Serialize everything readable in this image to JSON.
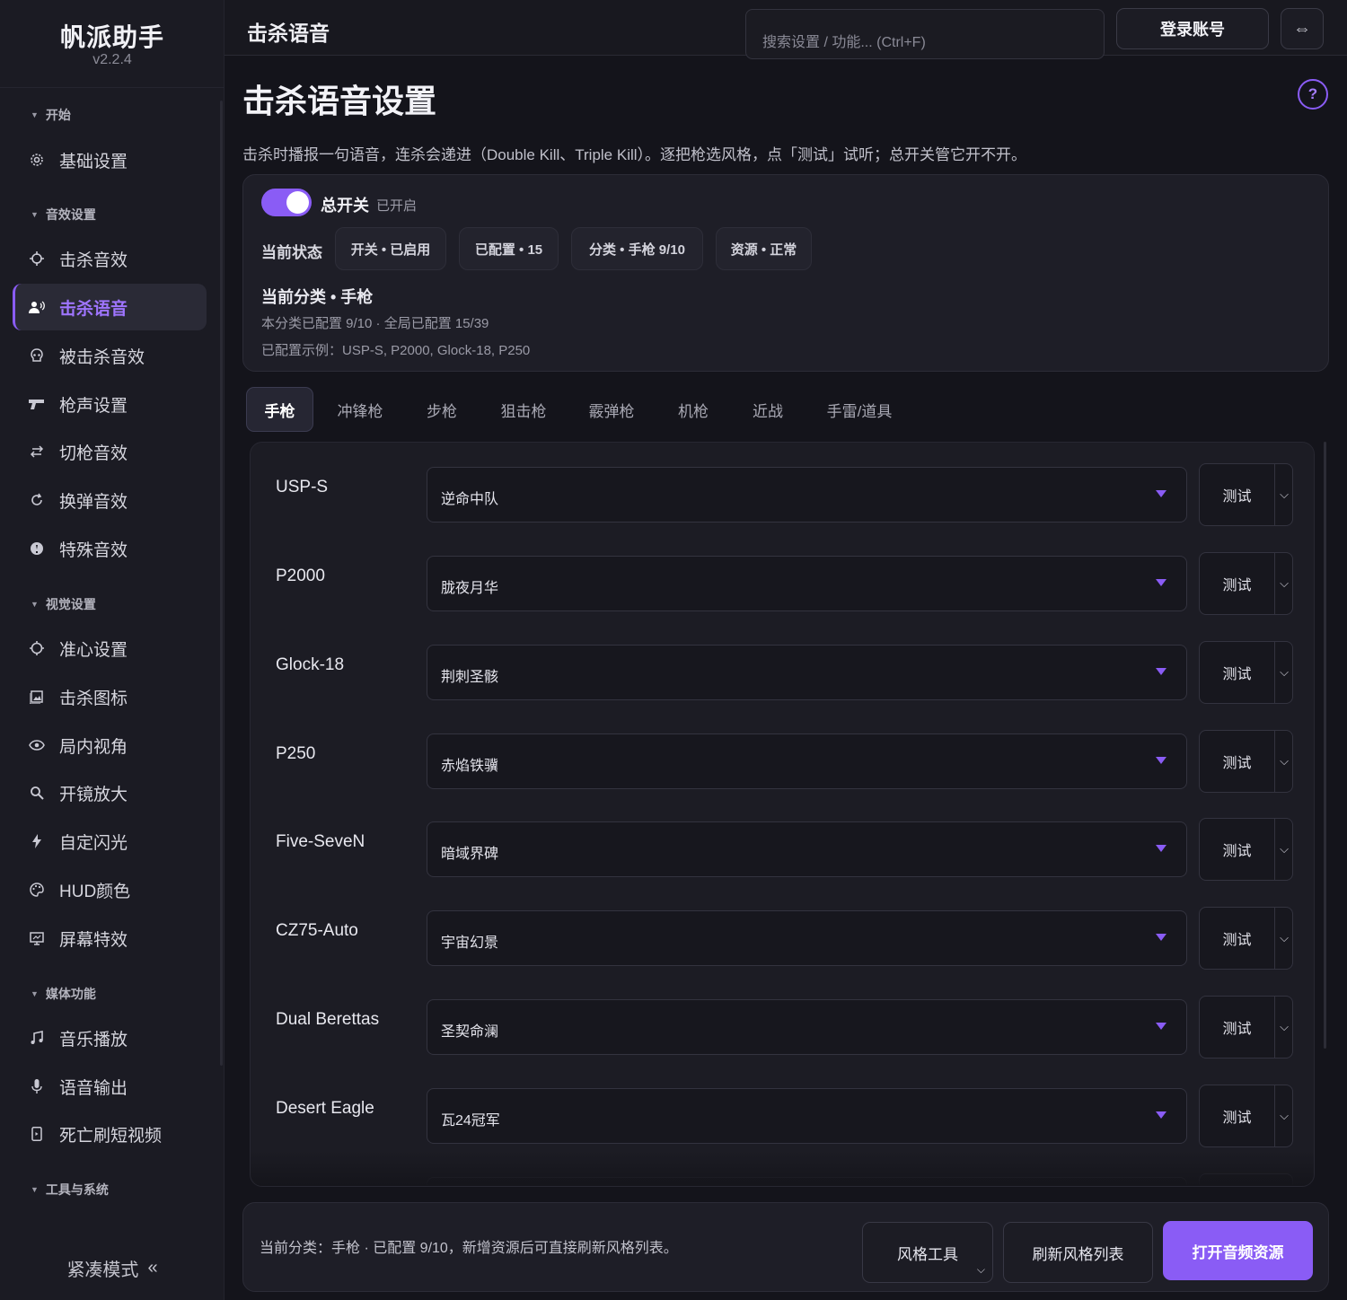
{
  "app": {
    "name": "帆派助手",
    "version": "v2.2.4"
  },
  "sidebar": {
    "groups": [
      {
        "label": "开始"
      },
      {
        "label": "音效设置"
      },
      {
        "label": "视觉设置"
      },
      {
        "label": "媒体功能"
      },
      {
        "label": "工具与系统"
      }
    ],
    "items": [
      {
        "label": "基础设置",
        "icon": "gear-icon"
      },
      {
        "label": "击杀音效",
        "icon": "crosshair-icon"
      },
      {
        "label": "击杀语音",
        "icon": "voice-icon",
        "active": true
      },
      {
        "label": "被击杀音效",
        "icon": "skull-icon"
      },
      {
        "label": "枪声设置",
        "icon": "gun-icon"
      },
      {
        "label": "切枪音效",
        "icon": "swap-icon"
      },
      {
        "label": "换弹音效",
        "icon": "reload-icon"
      },
      {
        "label": "特殊音效",
        "icon": "badge-icon"
      },
      {
        "label": "准心设置",
        "icon": "crosshair-circle-icon"
      },
      {
        "label": "击杀图标",
        "icon": "image-icon"
      },
      {
        "label": "局内视角",
        "icon": "eye-icon"
      },
      {
        "label": "开镜放大",
        "icon": "search-icon"
      },
      {
        "label": "自定闪光",
        "icon": "lightning-icon"
      },
      {
        "label": "HUD颜色",
        "icon": "palette-icon"
      },
      {
        "label": "屏幕特效",
        "icon": "monitor-icon"
      },
      {
        "label": "音乐播放",
        "icon": "music-icon"
      },
      {
        "label": "语音输出",
        "icon": "microphone-icon"
      },
      {
        "label": "死亡刷短视频",
        "icon": "phone-icon"
      }
    ],
    "compact_label": "紧凑模式",
    "compact_icon": "«"
  },
  "topbar": {
    "title": "击杀语音",
    "search_placeholder": "搜索设置 / 功能... (Ctrl+F)",
    "login_label": "登录账号",
    "swap_icon": "⇔"
  },
  "page": {
    "title": "击杀语音设置",
    "help": "?",
    "description": "击杀时播报一句语音，连杀会递进（Double Kill、Triple Kill）。逐把枪选风格，点「测试」试听；总开关管它开不开。"
  },
  "status": {
    "toggle_label": "总开关",
    "toggle_state": "已开启",
    "toggle_on": true,
    "state_label": "当前状态",
    "chips": [
      "开关 • 已启用",
      "已配置 • 15",
      "分类 • 手枪 9/10",
      "资源 • 正常"
    ],
    "category_title": "当前分类 • 手枪",
    "category_line1": "本分类已配置 9/10 · 全局已配置 15/39",
    "category_line2": "已配置示例：USP-S, P2000, Glock-18, P250"
  },
  "tabs": [
    "手枪",
    "冲锋枪",
    "步枪",
    "狙击枪",
    "霰弹枪",
    "机枪",
    "近战",
    "手雷/道具"
  ],
  "active_tab": 0,
  "weapons": [
    {
      "gun": "USP-S",
      "style": "逆命中队"
    },
    {
      "gun": "P2000",
      "style": "胧夜月华"
    },
    {
      "gun": "Glock-18",
      "style": "荆刺圣骸"
    },
    {
      "gun": "P250",
      "style": "赤焰铁骥"
    },
    {
      "gun": "Five-SeveN",
      "style": "暗域界碑"
    },
    {
      "gun": "CZ75-Auto",
      "style": "宇宙幻景"
    },
    {
      "gun": "Dual Berettas",
      "style": "圣契命澜"
    },
    {
      "gun": "Desert Eagle",
      "style": "瓦24冠军"
    }
  ],
  "test_label": "测试",
  "footer": {
    "text": "当前分类：手枪 · 已配置 9/10，新增资源后可直接刷新风格列表。",
    "buttons": [
      "风格工具",
      "刷新风格列表",
      "打开音频资源"
    ]
  },
  "colors": {
    "accent": "#8a5cf5",
    "background": "#14141b",
    "sidebar": "#1b1b23"
  }
}
